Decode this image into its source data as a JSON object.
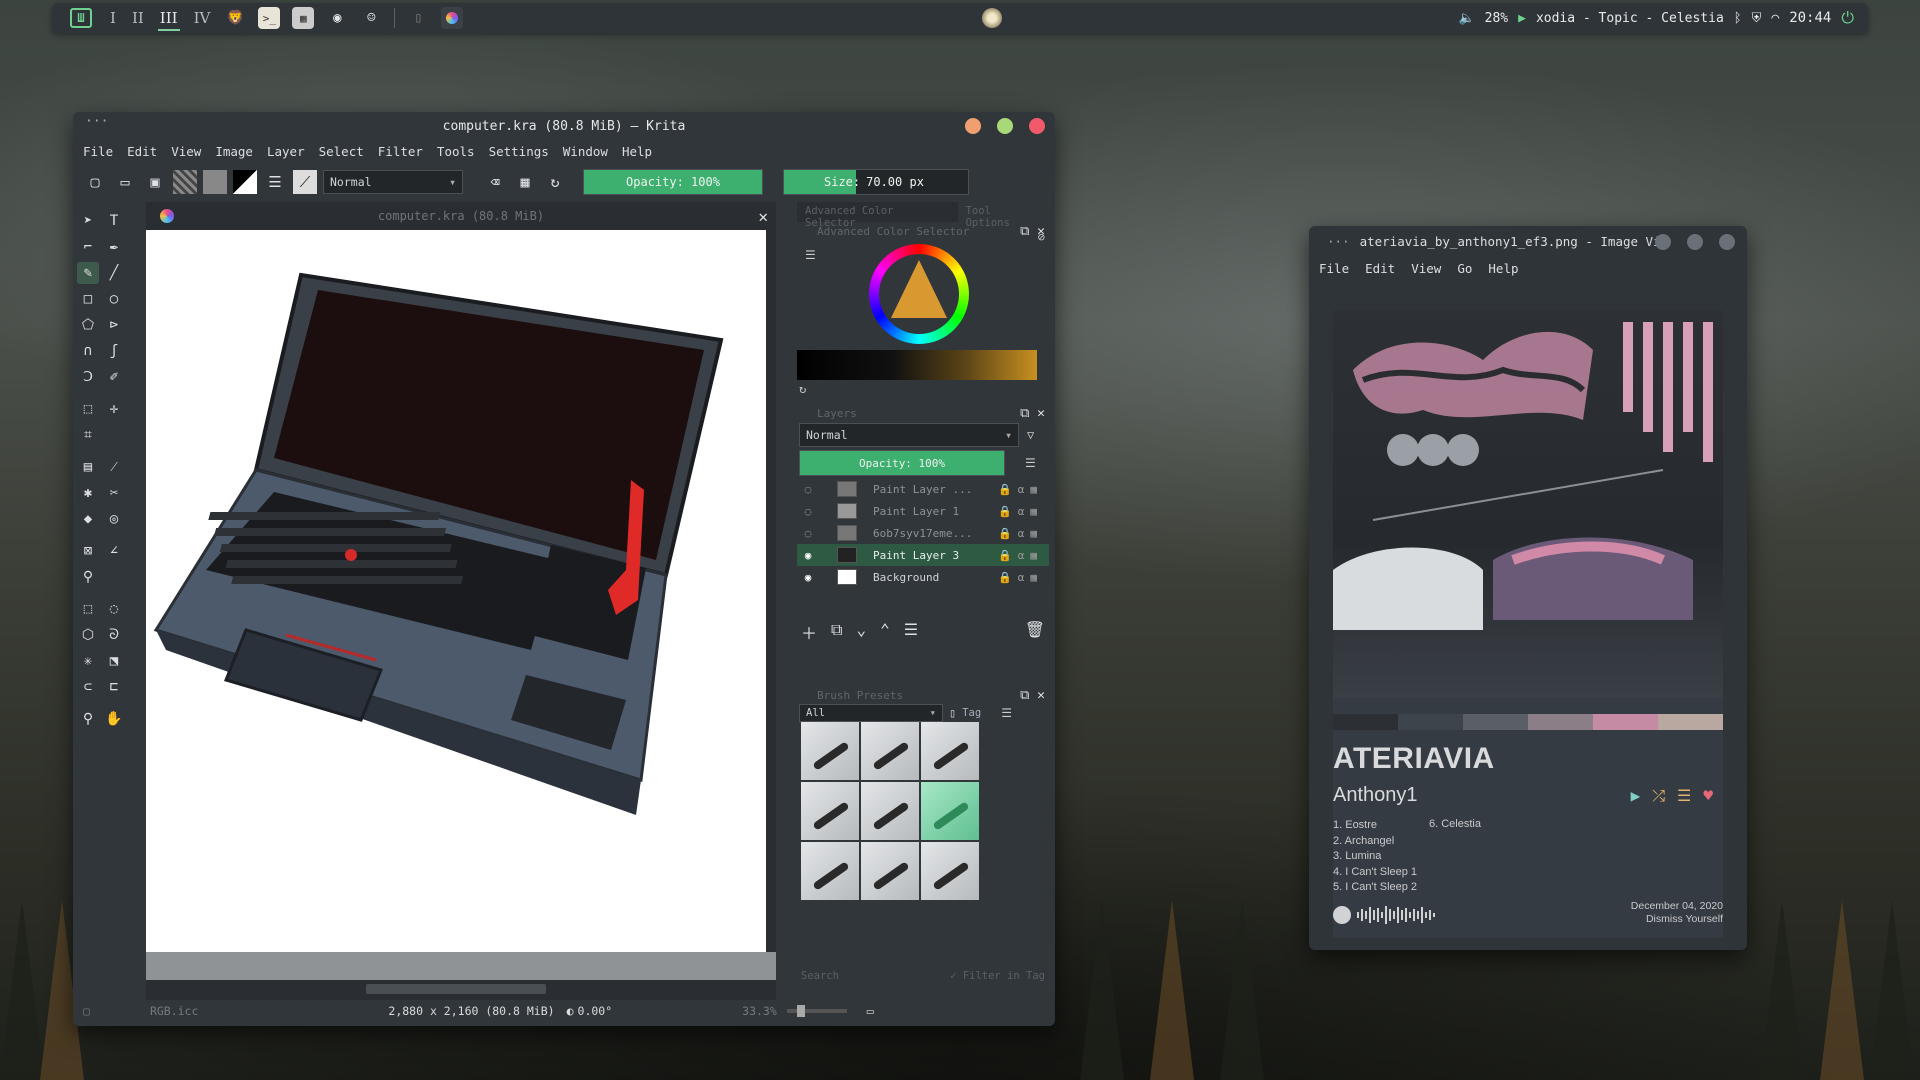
{
  "panel": {
    "workspaces": [
      "I",
      "II",
      "III",
      "IV"
    ],
    "active_workspace": "III",
    "volume": "28%",
    "now_playing": "xodia - Topic - Celestia",
    "clock": "20:44"
  },
  "krita": {
    "title": "computer.kra (80.8 MiB)  — Krita",
    "menu": [
      "File",
      "Edit",
      "View",
      "Image",
      "Layer",
      "Select",
      "Filter",
      "Tools",
      "Settings",
      "Window",
      "Help"
    ],
    "blend_mode": "Normal",
    "opacity_label": "Opacity: 100%",
    "opacity_value": 1.0,
    "size_label_prefix": "Size:",
    "size_value": "70.00 px",
    "doc_tab": "computer.kra (80.8 MiB)",
    "dock_tabs": [
      "Advanced Color Selector",
      "Tool Options"
    ],
    "color_selector_title": "Advanced Color Selector",
    "layers": {
      "title": "Layers",
      "blend_mode": "Normal",
      "opacity_label": "Opacity:  100%",
      "items": [
        {
          "name": "Paint Layer ...",
          "visible": false,
          "active": false
        },
        {
          "name": "Paint Layer 1",
          "visible": false,
          "active": false
        },
        {
          "name": "6ob7syv17eme...",
          "visible": false,
          "active": false
        },
        {
          "name": "Paint Layer 3",
          "visible": true,
          "active": true
        },
        {
          "name": "Background",
          "visible": true,
          "active": false
        }
      ]
    },
    "brush_presets": {
      "title": "Brush Presets",
      "filter": "All",
      "tag_label": "Tag",
      "search_placeholder": "Search",
      "filter_in_tag": "Filter in Tag"
    },
    "status": {
      "profile": "RGB.icc",
      "dimensions": "2,880 x 2,160 (80.8 MiB)",
      "rotation": "0.00°",
      "zoom": "33.3%"
    }
  },
  "viewer": {
    "title": "ateriavia_by_anthony1_ef3.png - Image Vi",
    "menu": [
      "File",
      "Edit",
      "View",
      "Go",
      "Help"
    ],
    "album": "ATERIAVIA",
    "artist": "Anthony1",
    "tracks_left": [
      "1. Eostre",
      "2. Archangel",
      "3. Lumina",
      "4. I Can't Sleep 1",
      "5. I Can't Sleep 2"
    ],
    "tracks_right": [
      "6. Celestia"
    ],
    "release_date": "December 04, 2020",
    "label": "Dismiss Yourself",
    "palette": [
      "#2c3034",
      "#3e444b",
      "#5a5e66",
      "#8c7e86",
      "#c58aa4",
      "#b8a8a0"
    ]
  }
}
